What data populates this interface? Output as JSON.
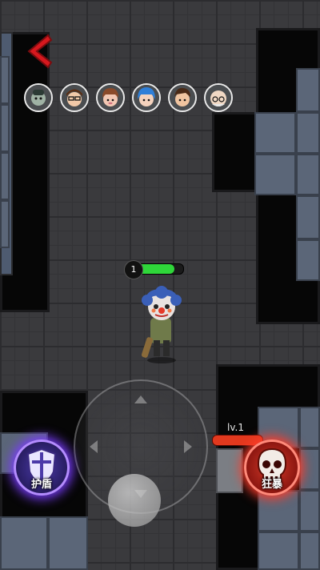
{
  "colors": {
    "back_arrow": "#d6181e",
    "hp_fill": "#2fd63a",
    "shield_glow": "#7a3cff",
    "rage_glow": "#ff3b2a",
    "rage_bar": "#e2391e"
  },
  "navigation": {
    "back_icon": "chevron-left-icon"
  },
  "players": [
    {
      "icon": "avatar-ghost-green"
    },
    {
      "icon": "avatar-glasses-boy"
    },
    {
      "icon": "avatar-brown-hair"
    },
    {
      "icon": "avatar-blue-hair"
    },
    {
      "icon": "avatar-brown-boy"
    },
    {
      "icon": "avatar-bald-glasses"
    }
  ],
  "hud": {
    "player_level": "1",
    "hp_fraction": 0.82
  },
  "skills": {
    "shield_label": "护盾",
    "rage_label": "狂暴",
    "rage_level": "lv.1",
    "rage_progress": 1.0
  }
}
